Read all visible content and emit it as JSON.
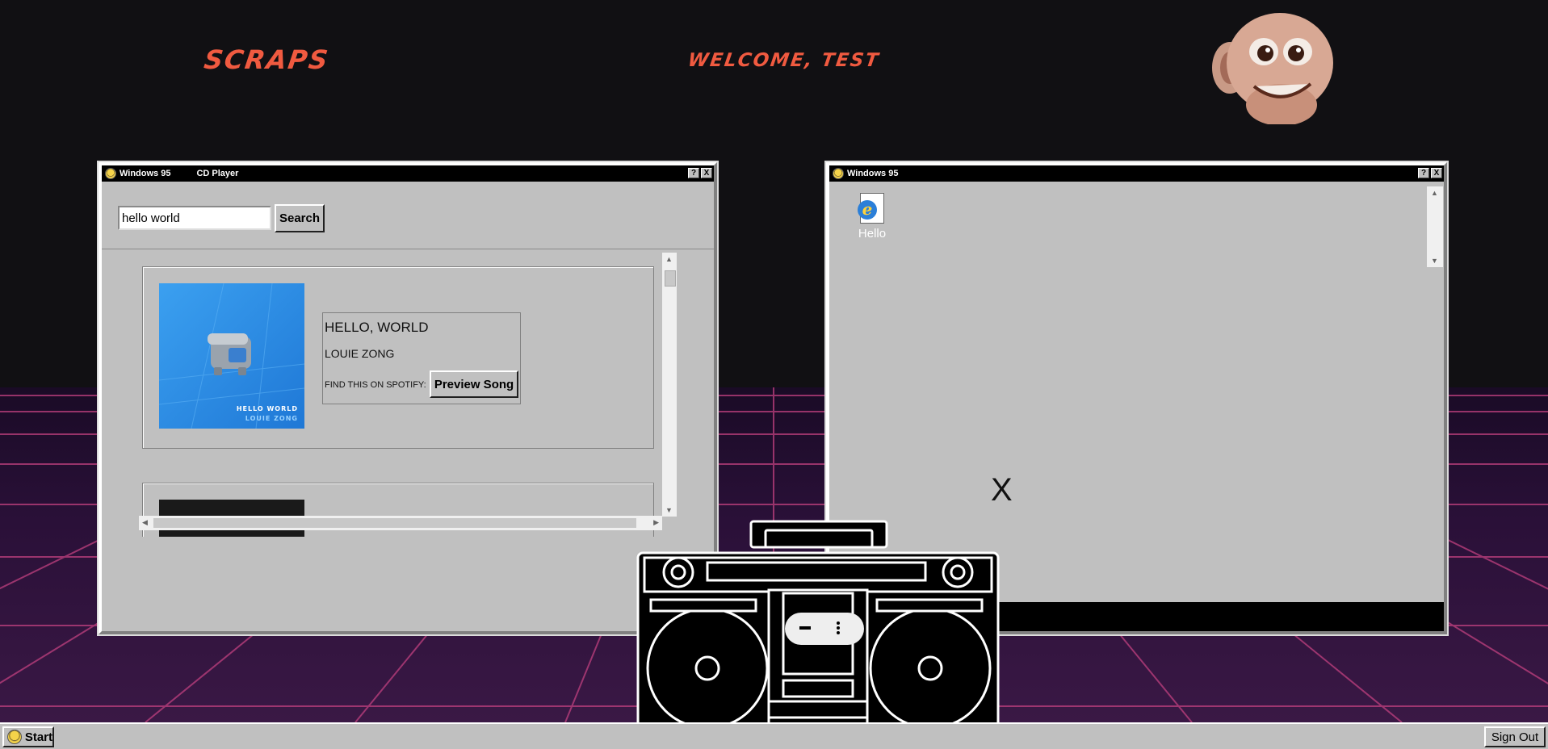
{
  "header": {
    "app_title": "SCRAPS",
    "welcome": "WELCOME, TEST"
  },
  "left_window": {
    "title": "Windows 95",
    "subtitle": "CD Player",
    "help_btn": "?",
    "close_btn": "X",
    "search": {
      "value": "hello world",
      "button": "Search"
    },
    "results": [
      {
        "title": "HELLO, WORLD",
        "artist": "LOUIE ZONG",
        "spotify_text": "FIND THIS ON SPOTIFY:",
        "preview_button": "Preview Song",
        "art_line1": "HELLO WORLD",
        "art_line2": "LOUIE ZONG"
      }
    ]
  },
  "right_window": {
    "title": "Windows 95",
    "help_btn": "?",
    "close_btn": "X",
    "desktop_icon_label": "Hello",
    "close_x": "X"
  },
  "taskbar": {
    "start_label": "Start",
    "signout_label": "Sign Out"
  },
  "colors": {
    "accent": "#f05a40",
    "window_bg": "#c0c0c0",
    "grid_line": "#c0407f"
  }
}
